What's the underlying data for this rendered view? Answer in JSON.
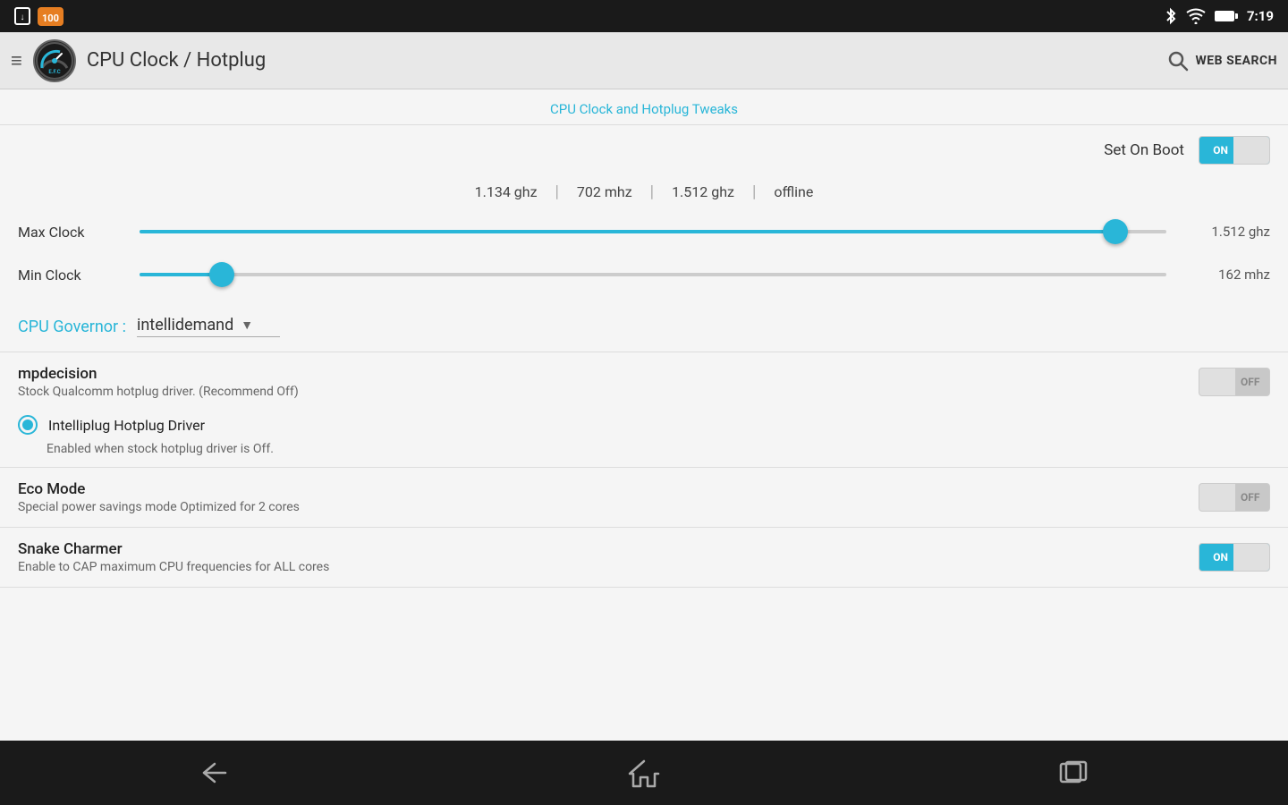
{
  "statusBar": {
    "time": "7:19",
    "icons": [
      "download",
      "100",
      "bluetooth",
      "wifi",
      "battery"
    ]
  },
  "appBar": {
    "title": "CPU Clock / Hotplug",
    "webSearch": "WEB SEARCH"
  },
  "sectionHeader": {
    "title": "CPU Clock and Hotplug Tweaks"
  },
  "setOnBoot": {
    "label": "Set On Boot",
    "state": "ON",
    "isOn": true
  },
  "cpuStats": {
    "stat1": "1.134 ghz",
    "stat2": "702 mhz",
    "stat3": "1.512 ghz",
    "stat4": "offline"
  },
  "maxClock": {
    "label": "Max Clock",
    "value": "1.512 ghz",
    "fillPercent": 95,
    "thumbPercent": 95
  },
  "minClock": {
    "label": "Min Clock",
    "value": "162 mhz",
    "fillPercent": 8,
    "thumbPercent": 8
  },
  "governor": {
    "label": "CPU Governor :",
    "value": "intellidemand"
  },
  "mpdecision": {
    "title": "mpdecision",
    "description": "Stock Qualcomm hotplug driver. (Recommend Off)",
    "state": "OFF",
    "isOn": false
  },
  "intelliplug": {
    "label": "Intelliplug Hotplug Driver",
    "description": "Enabled when stock hotplug driver is Off.",
    "checked": true
  },
  "ecoMode": {
    "title": "Eco Mode",
    "description": "Special power savings mode Optimized for 2 cores",
    "state": "OFF",
    "isOn": false
  },
  "snakeCharmer": {
    "title": "Snake Charmer",
    "description": "Enable to CAP maximum CPU frequencies for ALL cores",
    "state": "ON",
    "isOn": true
  },
  "nav": {
    "back": "back",
    "home": "home",
    "recent": "recent"
  }
}
